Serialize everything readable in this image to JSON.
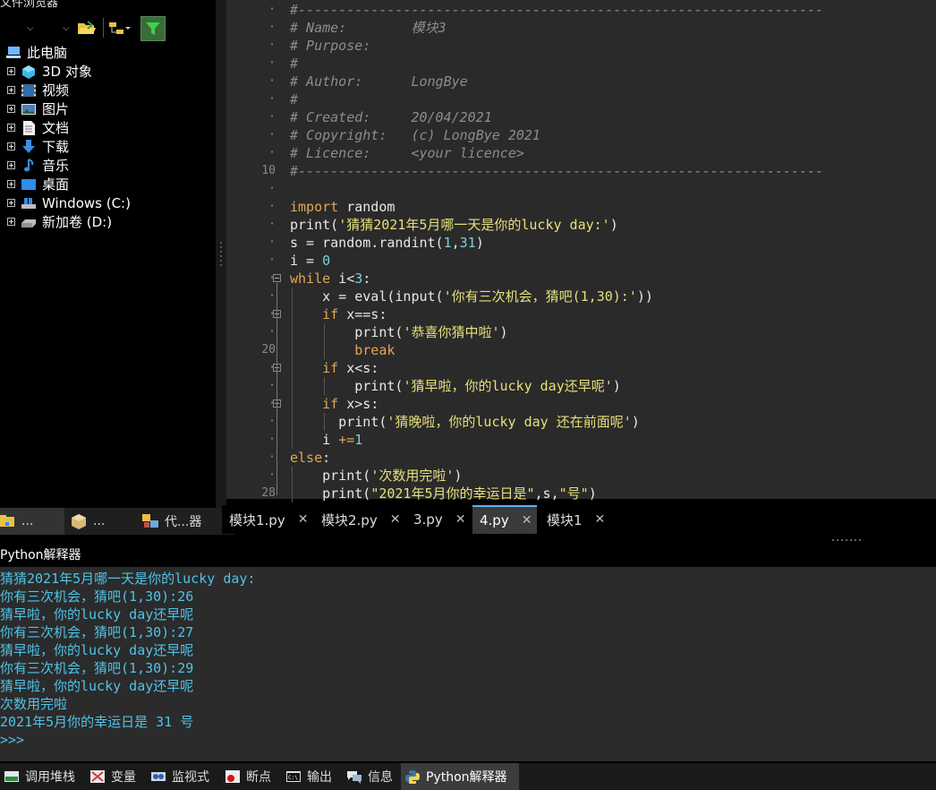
{
  "explorer": {
    "title": "文件浏览器",
    "tree": [
      {
        "label": "此电脑",
        "icon": "computer-icon",
        "expandable": false
      },
      {
        "label": "3D 对象",
        "icon": "3d-objects-icon",
        "expandable": true
      },
      {
        "label": "视频",
        "icon": "video-folder-icon",
        "expandable": true
      },
      {
        "label": "图片",
        "icon": "pictures-folder-icon",
        "expandable": true
      },
      {
        "label": "文档",
        "icon": "documents-folder-icon",
        "expandable": true
      },
      {
        "label": "下载",
        "icon": "download-folder-icon",
        "expandable": true
      },
      {
        "label": "音乐",
        "icon": "music-folder-icon",
        "expandable": true
      },
      {
        "label": "桌面",
        "icon": "desktop-folder-icon",
        "expandable": true
      },
      {
        "label": "Windows (C:)",
        "icon": "windows-drive-icon",
        "expandable": true
      },
      {
        "label": "新加卷 (D:)",
        "icon": "drive-icon",
        "expandable": true
      }
    ],
    "tabs": [
      {
        "label": "...",
        "icon": "folder-tab-icon"
      },
      {
        "label": "...",
        "icon": "package-tab-icon"
      },
      {
        "label": "代...器",
        "icon": "code-explorer-icon"
      }
    ]
  },
  "editor": {
    "lines": [
      {
        "n": "·",
        "fold": "",
        "parts": [
          {
            "c": "cm",
            "t": "#-----------------------------------------------------------------"
          }
        ]
      },
      {
        "n": "·",
        "fold": "",
        "parts": [
          {
            "c": "cm",
            "t": "# Name:        模块3"
          }
        ]
      },
      {
        "n": "·",
        "fold": "",
        "parts": [
          {
            "c": "cm",
            "t": "# Purpose:"
          }
        ]
      },
      {
        "n": "·",
        "fold": "",
        "parts": [
          {
            "c": "cm",
            "t": "#"
          }
        ]
      },
      {
        "n": "·",
        "fold": "",
        "parts": [
          {
            "c": "cm",
            "t": "# Author:      LongBye"
          }
        ]
      },
      {
        "n": "·",
        "fold": "",
        "parts": [
          {
            "c": "cm",
            "t": "#"
          }
        ]
      },
      {
        "n": "·",
        "fold": "",
        "parts": [
          {
            "c": "cm",
            "t": "# Created:     20/04/2021"
          }
        ]
      },
      {
        "n": "·",
        "fold": "",
        "parts": [
          {
            "c": "cm",
            "t": "# Copyright:   (c) LongBye 2021"
          }
        ]
      },
      {
        "n": "·",
        "fold": "",
        "parts": [
          {
            "c": "cm",
            "t": "# Licence:     <your licence>"
          }
        ]
      },
      {
        "n": "10",
        "fold": "",
        "parts": [
          {
            "c": "cm",
            "t": "#-----------------------------------------------------------------"
          }
        ]
      },
      {
        "n": "·",
        "fold": "",
        "parts": []
      },
      {
        "n": "·",
        "fold": "",
        "parts": [
          {
            "c": "kw",
            "t": "import"
          },
          {
            "c": "tx",
            "t": " random"
          }
        ]
      },
      {
        "n": "·",
        "fold": "",
        "parts": [
          {
            "c": "tx",
            "t": "print("
          },
          {
            "c": "st",
            "t": "'猜猜2021年5月哪一天是你的lucky day:'"
          },
          {
            "c": "tx",
            "t": ")"
          }
        ]
      },
      {
        "n": "·",
        "fold": "",
        "parts": [
          {
            "c": "tx",
            "t": "s = random.randint("
          },
          {
            "c": "nm",
            "t": "1"
          },
          {
            "c": "tx",
            "t": ","
          },
          {
            "c": "nm",
            "t": "31"
          },
          {
            "c": "tx",
            "t": ")"
          }
        ]
      },
      {
        "n": "·",
        "fold": "",
        "parts": [
          {
            "c": "tx",
            "t": "i = "
          },
          {
            "c": "nm",
            "t": "0"
          }
        ]
      },
      {
        "n": "·",
        "fold": "box",
        "parts": [
          {
            "c": "kw",
            "t": "while"
          },
          {
            "c": "tx",
            "t": " i<"
          },
          {
            "c": "nm",
            "t": "3"
          },
          {
            "c": "tx",
            "t": ":"
          }
        ]
      },
      {
        "n": "·",
        "fold": "",
        "parts": [
          {
            "c": "tx",
            "t": "    x = eval(input("
          },
          {
            "c": "st",
            "t": "'你有三次机会，猜吧(1,30):'"
          },
          {
            "c": "tx",
            "t": "))"
          }
        ]
      },
      {
        "n": "·",
        "fold": "box",
        "parts": [
          {
            "c": "tx",
            "t": "    "
          },
          {
            "c": "kw",
            "t": "if"
          },
          {
            "c": "tx",
            "t": " x==s:"
          }
        ]
      },
      {
        "n": "·",
        "fold": "",
        "parts": [
          {
            "c": "tx",
            "t": "        print("
          },
          {
            "c": "st",
            "t": "'恭喜你猜中啦'"
          },
          {
            "c": "tx",
            "t": ")"
          }
        ]
      },
      {
        "n": "20",
        "fold": "",
        "parts": [
          {
            "c": "tx",
            "t": "        "
          },
          {
            "c": "kw",
            "t": "break"
          }
        ]
      },
      {
        "n": "·",
        "fold": "box",
        "parts": [
          {
            "c": "tx",
            "t": "    "
          },
          {
            "c": "kw",
            "t": "if"
          },
          {
            "c": "tx",
            "t": " x<s:"
          }
        ]
      },
      {
        "n": "·",
        "fold": "",
        "parts": [
          {
            "c": "tx",
            "t": "        print("
          },
          {
            "c": "st",
            "t": "'猜早啦，你的lucky day还早呢'"
          },
          {
            "c": "tx",
            "t": ")"
          }
        ]
      },
      {
        "n": "·",
        "fold": "box",
        "parts": [
          {
            "c": "tx",
            "t": "    "
          },
          {
            "c": "kw",
            "t": "if"
          },
          {
            "c": "tx",
            "t": " x>s:"
          }
        ]
      },
      {
        "n": "·",
        "fold": "",
        "parts": [
          {
            "c": "tx",
            "t": "      print("
          },
          {
            "c": "st",
            "t": "'猜晚啦，你的lucky day 还在前面呢'"
          },
          {
            "c": "tx",
            "t": ")"
          }
        ]
      },
      {
        "n": "·",
        "fold": "",
        "parts": [
          {
            "c": "tx",
            "t": "    i "
          },
          {
            "c": "kw",
            "t": "+="
          },
          {
            "c": "nm",
            "t": "1"
          }
        ]
      },
      {
        "n": "·",
        "fold": "",
        "parts": [
          {
            "c": "kw",
            "t": "else"
          },
          {
            "c": "tx",
            "t": ":"
          }
        ]
      },
      {
        "n": "·",
        "fold": "",
        "parts": [
          {
            "c": "tx",
            "t": "    print("
          },
          {
            "c": "st",
            "t": "'次数用完啦'"
          },
          {
            "c": "tx",
            "t": ")"
          }
        ]
      },
      {
        "n": "28",
        "fold": "",
        "parts": [
          {
            "c": "tx",
            "t": "    print("
          },
          {
            "c": "st",
            "t": "\"2021年5月你的幸运日是\""
          },
          {
            "c": "tx",
            "t": ",s,"
          },
          {
            "c": "st",
            "t": "\"号\""
          },
          {
            "c": "tx",
            "t": ")"
          }
        ]
      }
    ],
    "tabs": [
      {
        "label": "模块1.py",
        "close": "✕",
        "active": false
      },
      {
        "label": "模块2.py",
        "close": "✕",
        "active": false
      },
      {
        "label": "3.py",
        "close": "✕",
        "active": false
      },
      {
        "label": "4.py",
        "close": "✕",
        "active": true
      },
      {
        "label": "模块1",
        "close": "✕",
        "active": false
      }
    ]
  },
  "interpreter": {
    "title": "Python解释器",
    "output": [
      "猜猜2021年5月哪一天是你的lucky day:",
      "你有三次机会，猜吧(1,30):26",
      "猜早啦，你的lucky day还早呢",
      "你有三次机会，猜吧(1,30):27",
      "猜早啦，你的lucky day还早呢",
      "你有三次机会，猜吧(1,30):29",
      "猜早啦，你的lucky day还早呢",
      "次数用完啦",
      "2021年5月你的幸运日是 31 号",
      ">>>"
    ]
  },
  "bottom_tabs": [
    {
      "label": "调用堆栈",
      "icon": "call-stack-icon",
      "active": false
    },
    {
      "label": "变量",
      "icon": "variables-icon",
      "active": false
    },
    {
      "label": "监视式",
      "icon": "watch-icon",
      "active": false
    },
    {
      "label": "断点",
      "icon": "breakpoint-icon",
      "active": false
    },
    {
      "label": "输出",
      "icon": "output-icon",
      "active": false
    },
    {
      "label": "信息",
      "icon": "messages-icon",
      "active": false
    },
    {
      "label": "Python解释器",
      "icon": "python-icon",
      "active": true
    }
  ],
  "colors": {
    "comment": "#8c8c8c",
    "keyword": "#e3a556",
    "number": "#7fd1d6",
    "string": "#e6e07a",
    "output": "#4fc3e8",
    "active_tab_accent": "#5ab0f0"
  }
}
